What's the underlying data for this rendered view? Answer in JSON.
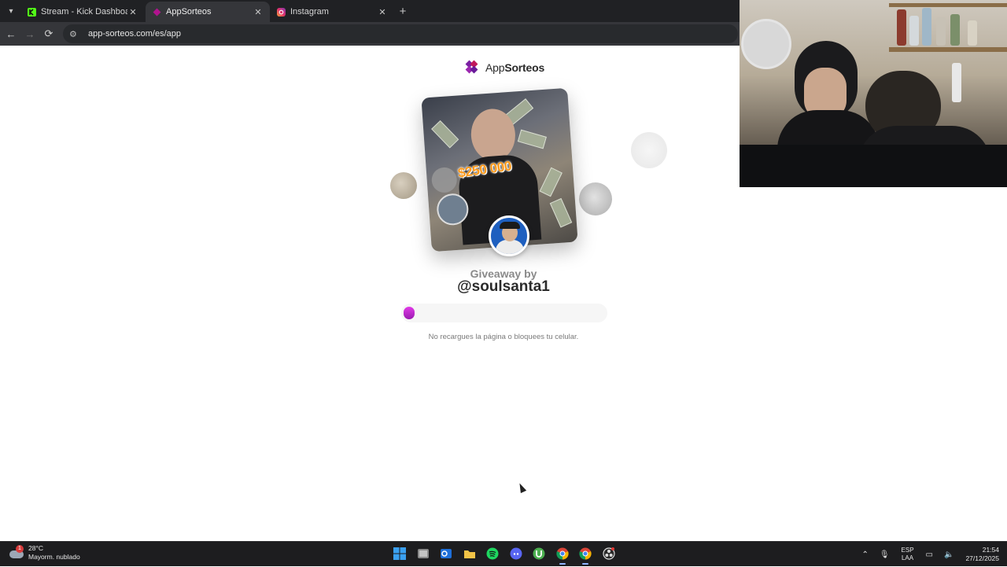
{
  "browser": {
    "tabs": [
      {
        "title": "Stream - Kick Dashboard",
        "icon": "kick-icon",
        "active": false
      },
      {
        "title": "AppSorteos",
        "icon": "appsorteos-icon",
        "active": true
      },
      {
        "title": "Instagram",
        "icon": "instagram-icon",
        "active": false
      }
    ],
    "url": "app-sorteos.com/es/app"
  },
  "page": {
    "brand": {
      "prefix": "App",
      "name": "Sorteos"
    },
    "card": {
      "prize_text": "$250 000"
    },
    "giveaway_label": "Giveaway by",
    "handle": "@soulsanta1",
    "progress": 0.02,
    "note": "No recargues la página o bloquees tu celular.",
    "colors": {
      "accent": "#c026d3",
      "prize": "#ff9a1a"
    }
  },
  "taskbar": {
    "weather": {
      "temp": "28°C",
      "condition": "Mayorm. nublado",
      "badge": "1"
    },
    "apps": [
      "windows-start-icon",
      "file-manager-icon",
      "outlook-icon",
      "folder-icon",
      "spotify-icon",
      "discord-icon",
      "utorrent-icon",
      "chrome-icon",
      "chrome-profile-icon",
      "obs-icon"
    ],
    "lang": {
      "line1": "ESP",
      "line2": "LAA"
    },
    "clock": {
      "time": "21:54",
      "date": "27/12/2025"
    }
  }
}
